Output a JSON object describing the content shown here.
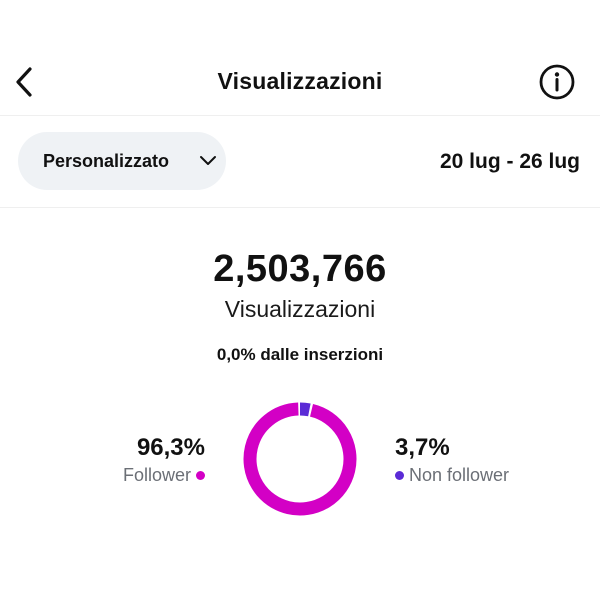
{
  "header": {
    "title": "Visualizzazioni",
    "back_icon": "chevron-left-icon",
    "info_icon": "info-circle-icon"
  },
  "filters": {
    "period_label": "Personalizzato",
    "period_icon": "chevron-down-icon",
    "date_range": "20 lug - 26 lug"
  },
  "summary": {
    "total": "2,503,766",
    "total_label": "Visualizzazioni",
    "ads_note": "0,0% dalle inserzioni"
  },
  "breakdown": {
    "follower": {
      "value": "96,3%",
      "label": "Follower",
      "fraction": 0.963,
      "color": "#d300c5"
    },
    "non_follower": {
      "value": "3,7%",
      "label": "Non follower",
      "fraction": 0.037,
      "color": "#5b2bd6"
    }
  }
}
